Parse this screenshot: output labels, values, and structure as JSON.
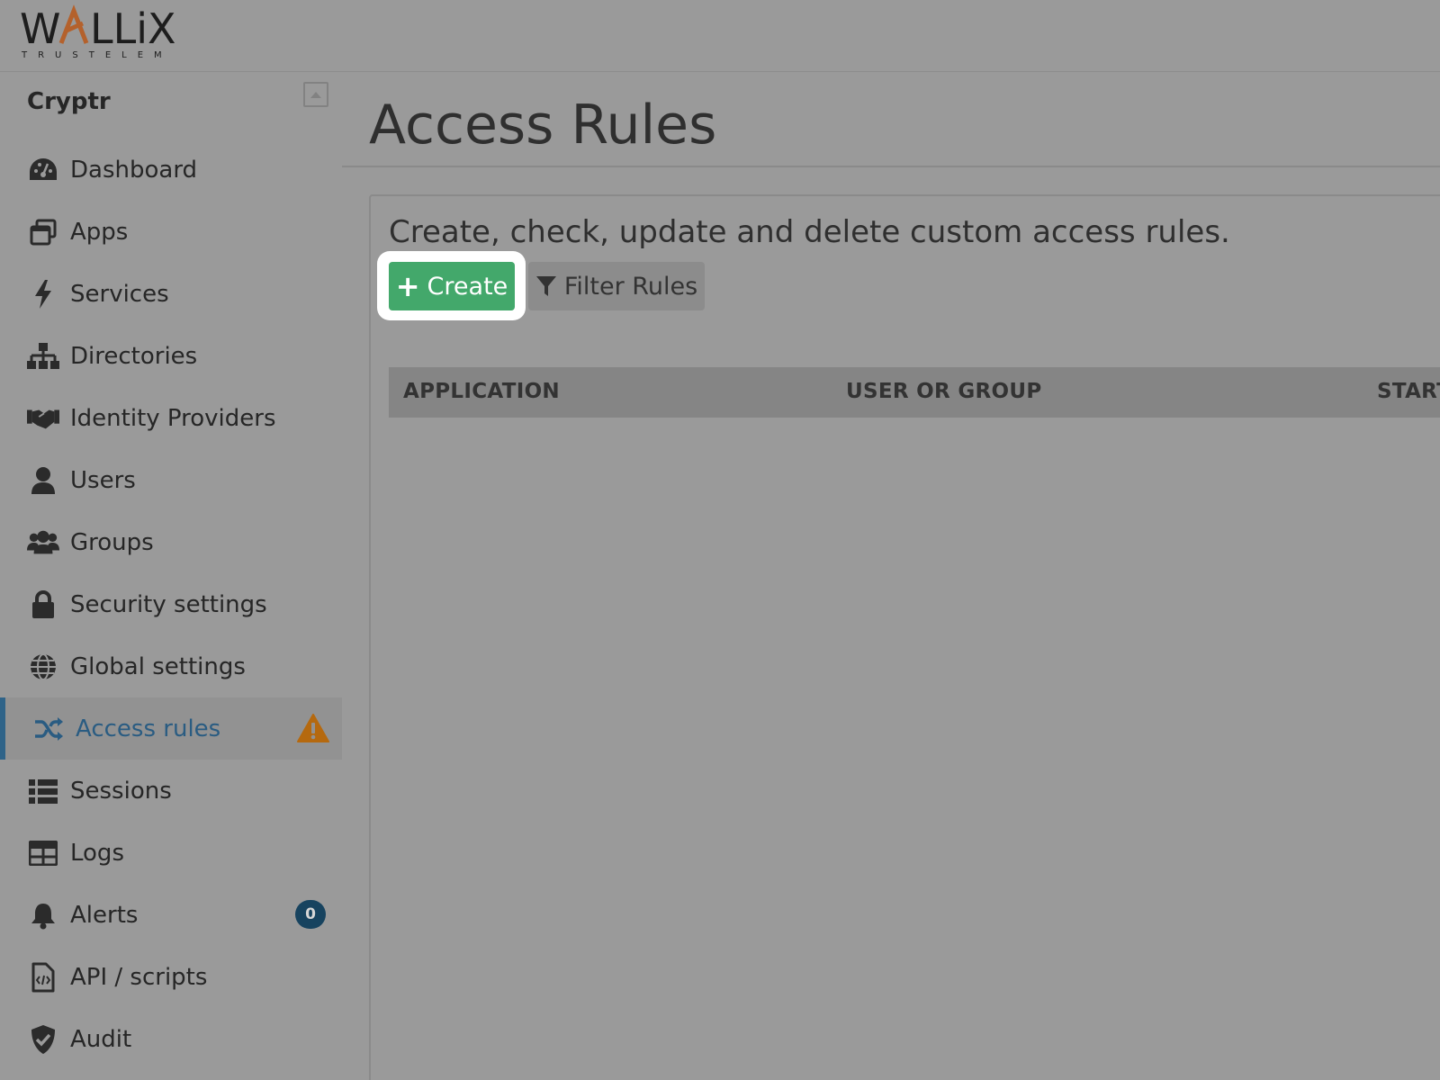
{
  "header": {
    "logo_main": "WALLIX",
    "logo_sub": "TRUSTELEM"
  },
  "sidebar": {
    "org_name": "Cryptr",
    "items": [
      {
        "label": "Dashboard",
        "icon": "dashboard-icon"
      },
      {
        "label": "Apps",
        "icon": "apps-icon"
      },
      {
        "label": "Services",
        "icon": "bolt-icon"
      },
      {
        "label": "Directories",
        "icon": "sitemap-icon"
      },
      {
        "label": "Identity Providers",
        "icon": "handshake-icon"
      },
      {
        "label": "Users",
        "icon": "user-icon"
      },
      {
        "label": "Groups",
        "icon": "users-icon"
      },
      {
        "label": "Security settings",
        "icon": "lock-icon"
      },
      {
        "label": "Global settings",
        "icon": "globe-icon"
      },
      {
        "label": "Access rules",
        "icon": "shuffle-icon",
        "active": true,
        "warning": true
      },
      {
        "label": "Sessions",
        "icon": "list-icon"
      },
      {
        "label": "Logs",
        "icon": "table-icon"
      },
      {
        "label": "Alerts",
        "icon": "bell-icon",
        "badge": "0"
      },
      {
        "label": "API / scripts",
        "icon": "file-code-icon"
      },
      {
        "label": "Audit",
        "icon": "shield-check-icon"
      }
    ]
  },
  "main": {
    "title": "Access Rules",
    "description": "Create, check, update and delete custom access rules.",
    "create_label": "Create",
    "filter_label": "Filter Rules",
    "table": {
      "columns": [
        "APPLICATION",
        "USER OR GROUP",
        "START"
      ]
    }
  },
  "colors": {
    "accent_blue": "#2a5c82",
    "create_green": "#43a86b",
    "warning_orange": "#b5690f",
    "badge_navy": "#17435f"
  }
}
